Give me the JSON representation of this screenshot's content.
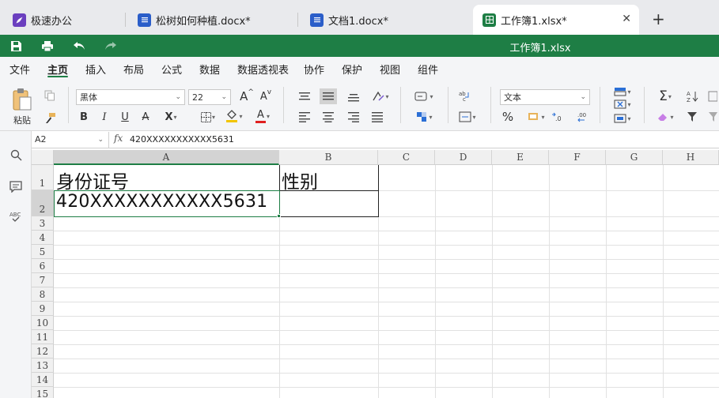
{
  "tabs": [
    {
      "label": "极速办公",
      "icon": "rocket-icon",
      "color": "#6b3fbf"
    },
    {
      "label": "松树如何种植.docx*",
      "icon": "doc-icon",
      "color": "#2b5ec9"
    },
    {
      "label": "文档1.docx*",
      "icon": "doc-icon",
      "color": "#2b5ec9"
    },
    {
      "label": "工作簿1.xlsx*",
      "icon": "sheet-icon",
      "color": "#1e7e45",
      "active": true
    }
  ],
  "close_glyph": "✕",
  "new_tab_glyph": "+",
  "title": "工作簿1.xlsx",
  "accent_color": "#1e7e45",
  "menu": [
    "文件",
    "主页",
    "插入",
    "布局",
    "公式",
    "数据",
    "数据透视表",
    "协作",
    "保护",
    "视图",
    "组件"
  ],
  "menu_active": "主页",
  "ribbon": {
    "paste_label": "粘贴",
    "font_name": "黑体",
    "font_size": "22",
    "number_format": "文本",
    "grow_font": "A",
    "shrink_font": "A",
    "bold": "B",
    "italic": "I",
    "underline": "U",
    "strike": "A",
    "subscript": "X",
    "font_color": "A",
    "percent": "%",
    "sigma": "Σ"
  },
  "formula_bar": {
    "cell_ref": "A2",
    "fx": "fx",
    "value": "420XXXXXXXXXXX5631"
  },
  "columns": [
    "A",
    "B",
    "C",
    "D",
    "E",
    "F",
    "G",
    "H"
  ],
  "rows": [
    "1",
    "2",
    "3",
    "4",
    "5",
    "6",
    "7",
    "8",
    "9",
    "10",
    "11",
    "12",
    "13",
    "14",
    "15"
  ],
  "cells": {
    "A1": "身份证号",
    "B1": "性别",
    "A2": "420XXXXXXXXXXX5631"
  },
  "selected_cell": "A2"
}
